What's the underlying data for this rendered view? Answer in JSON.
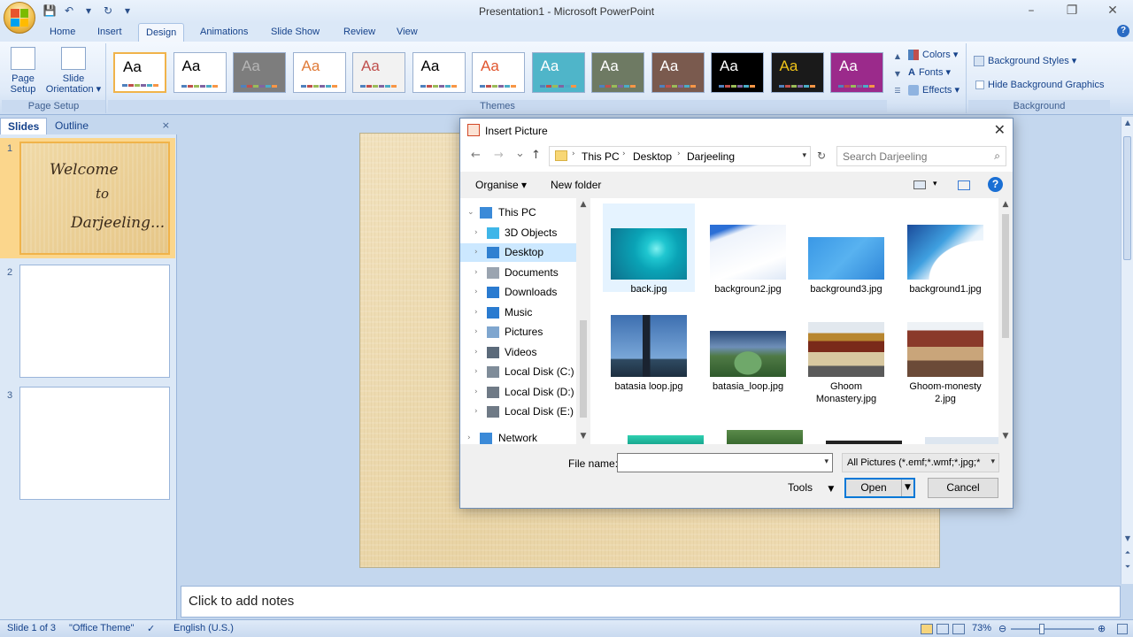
{
  "window": {
    "title": "Presentation1 - Microsoft PowerPoint",
    "minimize": "–",
    "restore": "❐",
    "close": "✕"
  },
  "qat": {
    "save": "💾",
    "undo": "↶",
    "dropdown": "▾",
    "redo": "↻",
    "customize": "▾"
  },
  "tabs": [
    "Home",
    "Insert",
    "Design",
    "Animations",
    "Slide Show",
    "Review",
    "View"
  ],
  "ribbon": {
    "page_setup": {
      "page_setup_label": "Page Setup",
      "orientation_label": "Slide Orientation ▾",
      "group_label": "Page Setup"
    },
    "themes": {
      "group_label": "Themes",
      "items": [
        {
          "label": "Aa",
          "bg": "#ffffff",
          "fg": "#000000"
        },
        {
          "label": "Aa",
          "bg": "#ffffff",
          "fg": "#000000"
        },
        {
          "label": "Aa",
          "bg": "#7d7d7d",
          "fg": "#b5b5b5"
        },
        {
          "label": "Aa",
          "bg": "#ffffff",
          "fg": "#e07b39"
        },
        {
          "label": "Aa",
          "bg": "#f2f2f2",
          "fg": "#c0504d"
        },
        {
          "label": "Aa",
          "bg": "#ffffff",
          "fg": "#000000"
        },
        {
          "label": "Aa",
          "bg": "#ffffff",
          "fg": "#e0552e"
        },
        {
          "label": "Aa",
          "bg": "#4fb5c9",
          "fg": "#ffffff"
        },
        {
          "label": "Aa",
          "bg": "#6e7a63",
          "fg": "#ffffff"
        },
        {
          "label": "Aa",
          "bg": "#7a5a4e",
          "fg": "#ffffff"
        },
        {
          "label": "Aa",
          "bg": "#000000",
          "fg": "#ffffff"
        },
        {
          "label": "Aa",
          "bg": "#1a1a1a",
          "fg": "#f0c419"
        },
        {
          "label": "Aa",
          "bg": "#9b2a8b",
          "fg": "#ffffff"
        }
      ]
    },
    "colors_label": "Colors ▾",
    "fonts_label": "Fonts ▾",
    "effects_label": "Effects ▾",
    "background": {
      "styles_label": "Background Styles ▾",
      "hide_graphics_label": "Hide Background Graphics",
      "group_label": "Background"
    }
  },
  "pane": {
    "tab_slides": "Slides",
    "tab_outline": "Outline",
    "close": "×",
    "slides": [
      {
        "num": "1",
        "lines": [
          "Welcome",
          "to",
          "Darjeeling..."
        ]
      },
      {
        "num": "2"
      },
      {
        "num": "3"
      }
    ]
  },
  "notes_placeholder": "Click to add notes",
  "status": {
    "slide": "Slide 1 of 3",
    "theme": "\"Office Theme\"",
    "language": "English (U.S.)",
    "zoom": "73%"
  },
  "dialog": {
    "title": "Insert Picture",
    "close": "✕",
    "nav": {
      "back": "←",
      "forward": "→",
      "recent": "⌄",
      "up": "↑"
    },
    "breadcrumb": [
      "This PC",
      "Desktop",
      "Darjeeling"
    ],
    "search_placeholder": "Search Darjeeling",
    "organise_label": "Organise ▾",
    "new_folder_label": "New folder",
    "tree": [
      {
        "label": "This PC",
        "icon_color": "#3b8ad8",
        "expanded": true
      },
      {
        "label": "3D Objects",
        "icon_color": "#3fb6e8"
      },
      {
        "label": "Desktop",
        "icon_color": "#2f80d1",
        "selected": true
      },
      {
        "label": "Documents",
        "icon_color": "#9aa4b0"
      },
      {
        "label": "Downloads",
        "icon_color": "#2a7bd0"
      },
      {
        "label": "Music",
        "icon_color": "#2a7bd0"
      },
      {
        "label": "Pictures",
        "icon_color": "#7fa6cf"
      },
      {
        "label": "Videos",
        "icon_color": "#5b6a7a"
      },
      {
        "label": "Local Disk (C:)",
        "icon_color": "#7f8c99"
      },
      {
        "label": "Local Disk (D:)",
        "icon_color": "#6f7a86"
      },
      {
        "label": "Local Disk (E:)",
        "icon_color": "#6f7a86"
      },
      {
        "label": "Network",
        "icon_color": "#3b8ad8"
      }
    ],
    "files": [
      {
        "name": "back.jpg"
      },
      {
        "name": "backgroun2.jpg"
      },
      {
        "name": "background3.jpg"
      },
      {
        "name": "background1.jpg"
      },
      {
        "name": "batasia loop.jpg"
      },
      {
        "name": "batasia_loop.jpg"
      },
      {
        "name": "Ghoom Monastery.jpg"
      },
      {
        "name": "Ghoom-monesty 2.jpg"
      }
    ],
    "file_name_label": "File name:",
    "file_name_value": "",
    "filter_value": "All Pictures (*.emf;*.wmf;*.jpg;*",
    "tools_label": "Tools",
    "open_label": "Open",
    "cancel_label": "Cancel"
  }
}
